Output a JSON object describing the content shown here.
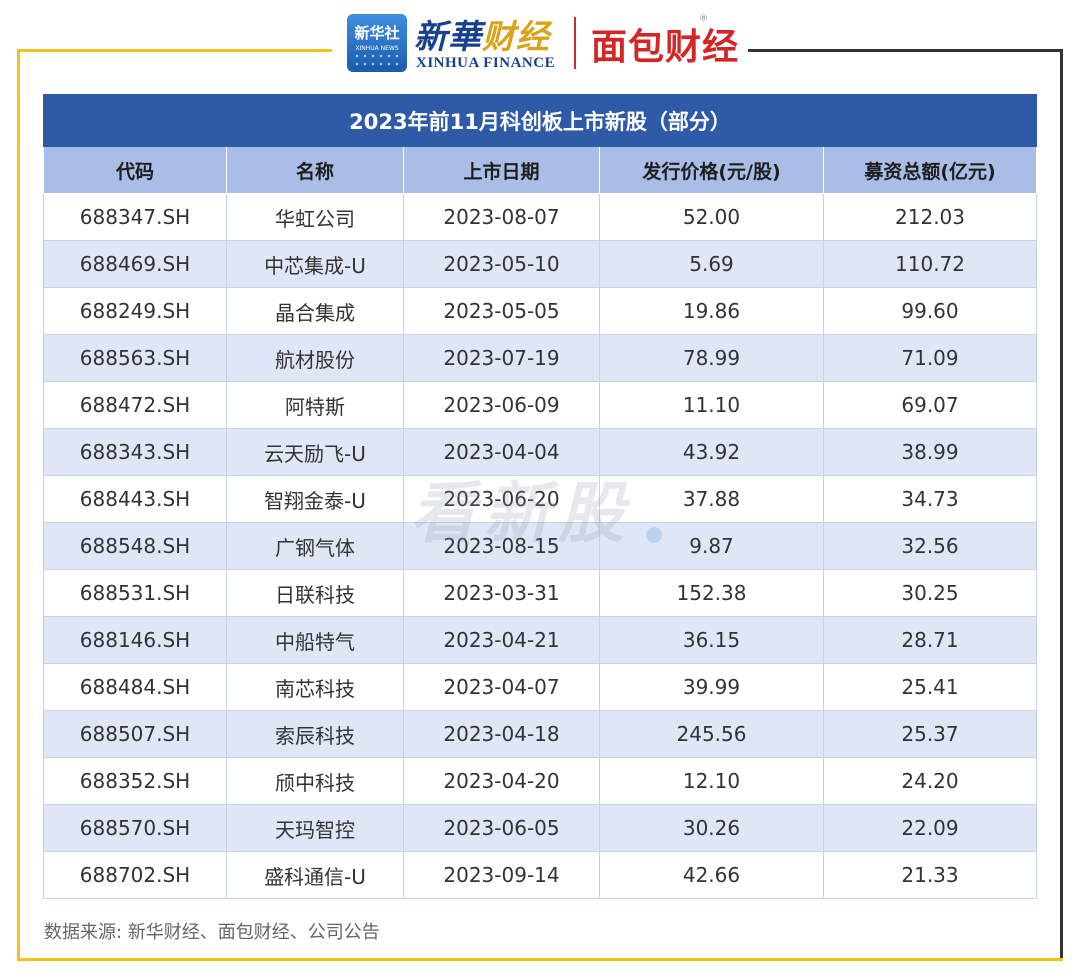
{
  "header": {
    "xinhua_she_label": "新华社",
    "xinhua_she_sub": "XINHUA NEWS",
    "brand_cn_prefix": "新華",
    "brand_cn_suffix": "财经",
    "brand_en": "XINHUA FINANCE",
    "brand_mianbao": "面包财经",
    "reg_mark": "®"
  },
  "table": {
    "title": "2023年前11月科创板上市新股（部分）",
    "columns": [
      "代码",
      "名称",
      "上市日期",
      "发行价格(元/股)",
      "募资总额(亿元)"
    ],
    "rows": [
      [
        "688347.SH",
        "华虹公司",
        "2023-08-07",
        "52.00",
        "212.03"
      ],
      [
        "688469.SH",
        "中芯集成-U",
        "2023-05-10",
        "5.69",
        "110.72"
      ],
      [
        "688249.SH",
        "晶合集成",
        "2023-05-05",
        "19.86",
        "99.60"
      ],
      [
        "688563.SH",
        "航材股份",
        "2023-07-19",
        "78.99",
        "71.09"
      ],
      [
        "688472.SH",
        "阿特斯",
        "2023-06-09",
        "11.10",
        "69.07"
      ],
      [
        "688343.SH",
        "云天励飞-U",
        "2023-04-04",
        "43.92",
        "38.99"
      ],
      [
        "688443.SH",
        "智翔金泰-U",
        "2023-06-20",
        "37.88",
        "34.73"
      ],
      [
        "688548.SH",
        "广钢气体",
        "2023-08-15",
        "9.87",
        "32.56"
      ],
      [
        "688531.SH",
        "日联科技",
        "2023-03-31",
        "152.38",
        "30.25"
      ],
      [
        "688146.SH",
        "中船特气",
        "2023-04-21",
        "36.15",
        "28.71"
      ],
      [
        "688484.SH",
        "南芯科技",
        "2023-04-07",
        "39.99",
        "25.41"
      ],
      [
        "688507.SH",
        "索辰科技",
        "2023-04-18",
        "245.56",
        "25.37"
      ],
      [
        "688352.SH",
        "颀中科技",
        "2023-04-20",
        "12.10",
        "24.20"
      ],
      [
        "688570.SH",
        "天玛智控",
        "2023-06-05",
        "30.26",
        "22.09"
      ],
      [
        "688702.SH",
        "盛科通信-U",
        "2023-09-14",
        "42.66",
        "21.33"
      ]
    ]
  },
  "watermark": "看新股",
  "source": "数据来源: 新华财经、面包财经、公司公告",
  "colors": {
    "title_bg": "#2f5aa8",
    "header_bg": "#a9bde6",
    "stripe_bg": "#dfe7f7",
    "frame_yellow": "#f2c21b",
    "brand_blue": "#17418e",
    "brand_red": "#d42626"
  }
}
